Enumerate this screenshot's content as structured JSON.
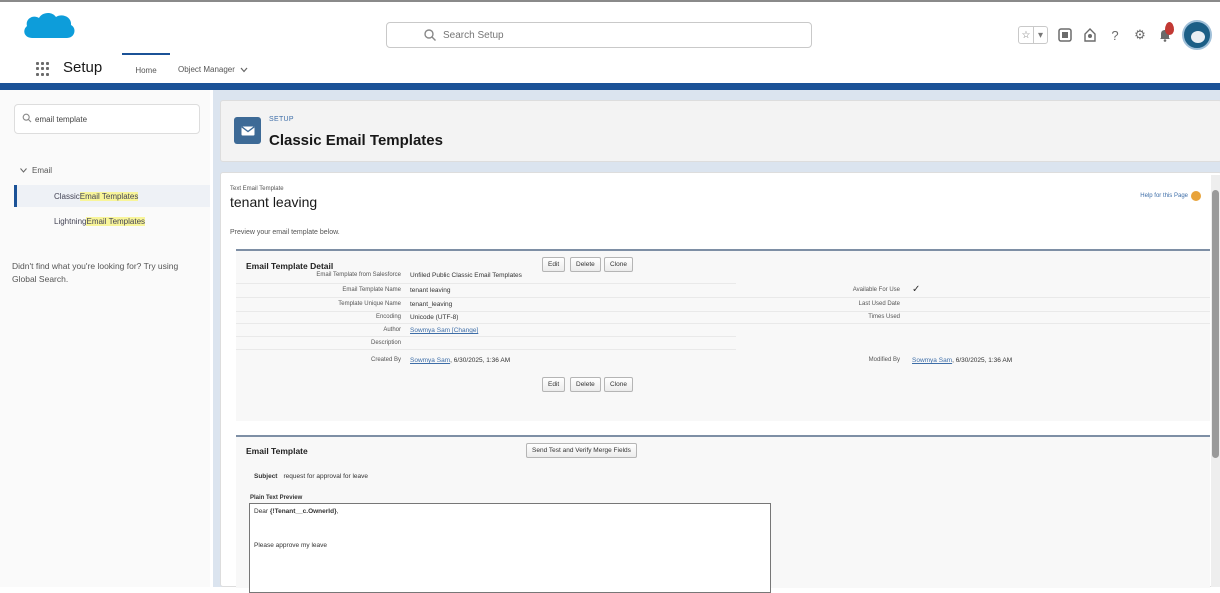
{
  "header": {
    "search_placeholder": "Search Setup",
    "icons": [
      "favorites-star-icon",
      "favorites-dropdown-icon",
      "global-actions-icon",
      "trailhead-icon",
      "help-icon",
      "gear-icon",
      "notifications-bell-icon",
      "user-avatar"
    ]
  },
  "nav": {
    "app_name": "Setup",
    "tabs": [
      {
        "label": "Home",
        "active": true
      },
      {
        "label": "Object Manager"
      }
    ]
  },
  "sidebar": {
    "quick_find_value": "email template",
    "group_label": "Email",
    "items": [
      {
        "prefix": "Classic ",
        "highlight": "Email Templates",
        "active": true
      },
      {
        "prefix": "Lightning ",
        "highlight": "Email Templates"
      }
    ],
    "not_found_text": "Didn't find what you're looking for? Try using Global Search."
  },
  "page_header": {
    "eyebrow": "SETUP",
    "title": "Classic Email Templates",
    "icon": "email-icon"
  },
  "content": {
    "record_type": "Text Email Template",
    "title": "tenant leaving",
    "help_link": "Help for this Page",
    "description": "Preview your email template below.",
    "detail": {
      "section_title": "Email Template Detail",
      "buttons": {
        "edit": "Edit",
        "delete": "Delete",
        "clone": "Clone"
      },
      "fields": {
        "folder_label": "Email Template from Salesforce",
        "folder_value": "Unfiled Public Classic Email Templates",
        "name_label": "Email Template Name",
        "name_value": "tenant leaving",
        "unique_label": "Template Unique Name",
        "unique_value": "tenant_leaving",
        "encoding_label": "Encoding",
        "encoding_value": "Unicode (UTF-8)",
        "author_label": "Author",
        "author_value": "Sowmya Sam [Change]",
        "description_label": "Description",
        "description_value": "",
        "created_label": "Created By",
        "created_user": "Sowmya Sam",
        "created_date": "6/30/2025, 1:36 AM",
        "available_label": "Available For Use",
        "available_value": "✓",
        "last_used_label": "Last Used Date",
        "last_used_value": "",
        "times_used_label": "Times Used",
        "times_used_value": "",
        "modified_label": "Modified By",
        "modified_user": "Sowmya Sam",
        "modified_date": "6/30/2025, 1:36 AM"
      }
    },
    "template": {
      "section_title": "Email Template",
      "send_test_button": "Send Test and Verify Merge Fields",
      "subject_label": "Subject",
      "subject_value": "request for approval for leave",
      "preview_label": "Plain Text Preview",
      "preview_line1_pre": "Dear ",
      "preview_line1_bold": "{!Tenant__c.OwnerId}",
      "preview_line1_post": ",",
      "preview_line2": "Please approve my leave"
    }
  },
  "colors": {
    "brand_blue": "#1b5297",
    "link_blue": "#3e6ea8",
    "header_icon_bg": "#3d6a96",
    "cloud_blue": "#0d9dda",
    "notification_red": "#c23934",
    "highlight_yellow": "#f8f59a",
    "main_background": "#dbe4ef"
  }
}
